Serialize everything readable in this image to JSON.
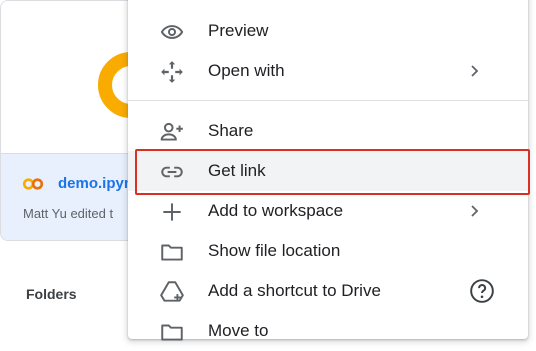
{
  "file_card": {
    "name": "demo.ipyn",
    "subtitle": "Matt Yu edited t"
  },
  "folders_label": "Folders",
  "menu": {
    "items": [
      {
        "label": "Preview",
        "icon": "eye-icon"
      },
      {
        "label": "Open with",
        "icon": "move-arrows-icon",
        "submenu": true
      },
      {
        "label": "Share",
        "icon": "person-add-icon"
      },
      {
        "label": "Get link",
        "icon": "link-icon",
        "highlighted": true
      },
      {
        "label": "Add to workspace",
        "icon": "plus-icon",
        "submenu": true
      },
      {
        "label": "Show file location",
        "icon": "folder-icon"
      },
      {
        "label": "Add a shortcut to Drive",
        "icon": "drive-shortcut-icon",
        "help": true
      },
      {
        "label": "Move to",
        "icon": "folder-move-icon"
      }
    ]
  },
  "colors": {
    "accent": "#1a73e8",
    "colab_orange": "#f9ab00",
    "highlight_border": "#d93025",
    "menu_hover": "#f1f3f4"
  }
}
